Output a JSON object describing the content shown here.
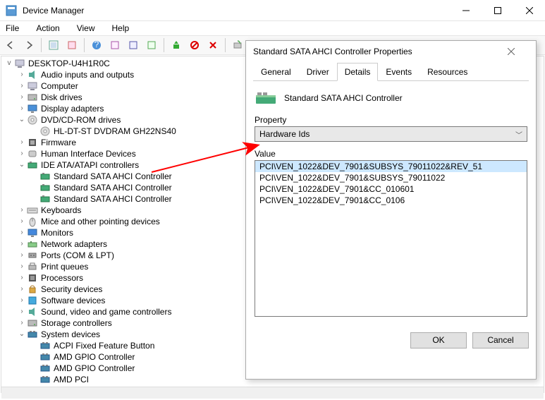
{
  "window": {
    "title": "Device Manager"
  },
  "menu": {
    "file": "File",
    "action": "Action",
    "view": "View",
    "help": "Help"
  },
  "tree": {
    "root": "DESKTOP-U4H1R0C",
    "items": [
      {
        "label": "Audio inputs and outputs",
        "exp": ">",
        "icon": "audio"
      },
      {
        "label": "Computer",
        "exp": ">",
        "icon": "computer"
      },
      {
        "label": "Disk drives",
        "exp": ">",
        "icon": "disk"
      },
      {
        "label": "Display adapters",
        "exp": ">",
        "icon": "display"
      },
      {
        "label": "DVD/CD-ROM drives",
        "exp": "v",
        "icon": "dvd",
        "children": [
          {
            "label": "HL-DT-ST DVDRAM GH22NS40",
            "icon": "dvd"
          }
        ]
      },
      {
        "label": "Firmware",
        "exp": ">",
        "icon": "firmware"
      },
      {
        "label": "Human Interface Devices",
        "exp": ">",
        "icon": "hid"
      },
      {
        "label": "IDE ATA/ATAPI controllers",
        "exp": "v",
        "icon": "ide",
        "children": [
          {
            "label": "Standard SATA AHCI Controller",
            "icon": "ide"
          },
          {
            "label": "Standard SATA AHCI Controller",
            "icon": "ide"
          },
          {
            "label": "Standard SATA AHCI Controller",
            "icon": "ide"
          }
        ]
      },
      {
        "label": "Keyboards",
        "exp": ">",
        "icon": "keyboard"
      },
      {
        "label": "Mice and other pointing devices",
        "exp": ">",
        "icon": "mouse"
      },
      {
        "label": "Monitors",
        "exp": ">",
        "icon": "monitor"
      },
      {
        "label": "Network adapters",
        "exp": ">",
        "icon": "net"
      },
      {
        "label": "Ports (COM & LPT)",
        "exp": ">",
        "icon": "port"
      },
      {
        "label": "Print queues",
        "exp": ">",
        "icon": "print"
      },
      {
        "label": "Processors",
        "exp": ">",
        "icon": "cpu"
      },
      {
        "label": "Security devices",
        "exp": ">",
        "icon": "security"
      },
      {
        "label": "Software devices",
        "exp": ">",
        "icon": "software"
      },
      {
        "label": "Sound, video and game controllers",
        "exp": ">",
        "icon": "sound"
      },
      {
        "label": "Storage controllers",
        "exp": ">",
        "icon": "storage"
      },
      {
        "label": "System devices",
        "exp": "v",
        "icon": "system",
        "children": [
          {
            "label": "ACPI Fixed Feature Button",
            "icon": "system"
          },
          {
            "label": "AMD GPIO Controller",
            "icon": "system"
          },
          {
            "label": "AMD GPIO Controller",
            "icon": "system"
          },
          {
            "label": "AMD PCI",
            "icon": "system"
          }
        ]
      }
    ]
  },
  "dialog": {
    "title": "Standard SATA AHCI Controller Properties",
    "tabs": {
      "general": "General",
      "driver": "Driver",
      "details": "Details",
      "events": "Events",
      "resources": "Resources"
    },
    "device_name": "Standard SATA AHCI Controller",
    "property_label": "Property",
    "property_value": "Hardware Ids",
    "value_label": "Value",
    "values": [
      "PCI\\VEN_1022&DEV_7901&SUBSYS_79011022&REV_51",
      "PCI\\VEN_1022&DEV_7901&SUBSYS_79011022",
      "PCI\\VEN_1022&DEV_7901&CC_010601",
      "PCI\\VEN_1022&DEV_7901&CC_0106"
    ],
    "ok": "OK",
    "cancel": "Cancel"
  }
}
